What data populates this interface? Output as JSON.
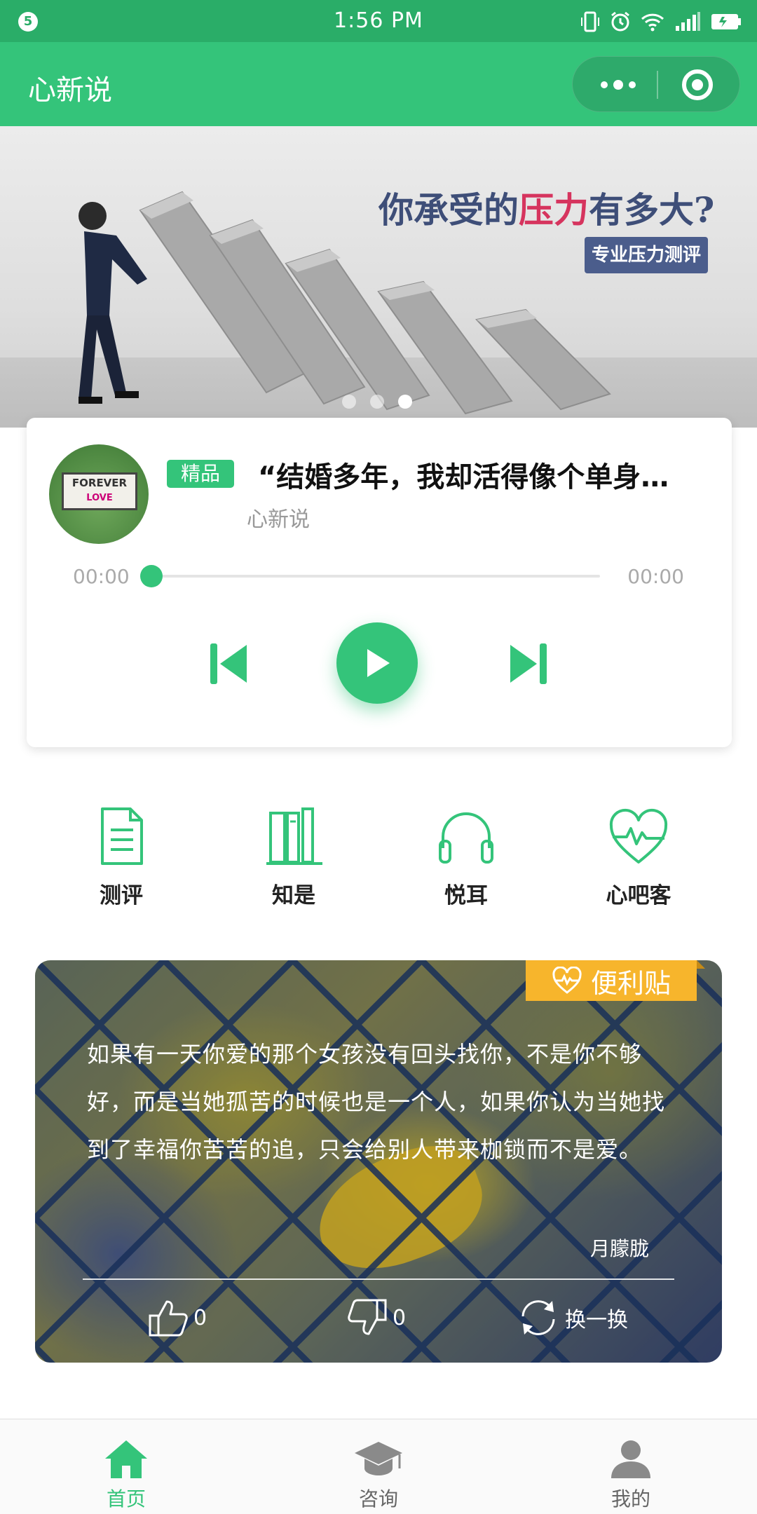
{
  "status_bar": {
    "notification_count": "5",
    "time": "1:56 PM"
  },
  "header": {
    "title": "心新说",
    "more_icon": "more-dots-icon",
    "close_icon": "record-circle-icon"
  },
  "banner": {
    "headline_prefix": "你承受的",
    "headline_highlight": "压力",
    "headline_suffix": "有多大?",
    "tag": "专业压力测评",
    "slide_count": 3,
    "active_slide": 3
  },
  "player": {
    "badge": "精品",
    "title": "“结婚多年，我却活得像个单身…",
    "author": "心新说",
    "current_time": "00:00",
    "duration": "00:00",
    "progress": 0,
    "cover_sign_line1": "FOREVER",
    "cover_sign_line2": "LOVE"
  },
  "menu": {
    "items": [
      {
        "label": "测评",
        "icon": "document-icon"
      },
      {
        "label": "知是",
        "icon": "books-icon"
      },
      {
        "label": "悦耳",
        "icon": "headphones-icon"
      },
      {
        "label": "心吧客",
        "icon": "heartbeat-icon"
      }
    ]
  },
  "note": {
    "ribbon": "便利贴",
    "quote": "如果有一天你爱的那个女孩没有回头找你，不是你不够好，而是当她孤苦的时候也是一个人，如果你认为当她找到了幸福你苦苦的追，只会给别人带来枷锁而不是爱。",
    "author": "月朦胧",
    "likes": "0",
    "dislikes": "0",
    "swap_label": "换一换"
  },
  "tabbar": {
    "tabs": [
      {
        "label": "首页",
        "icon": "home-icon",
        "active": true
      },
      {
        "label": "咨询",
        "icon": "graduation-cap-icon",
        "active": false
      },
      {
        "label": "我的",
        "icon": "user-icon",
        "active": false
      }
    ]
  },
  "colors": {
    "brand": "#34c47a",
    "brand_dark": "#2aad68",
    "ribbon": "#f7b52c",
    "tab_inactive": "#8a8a8a"
  }
}
